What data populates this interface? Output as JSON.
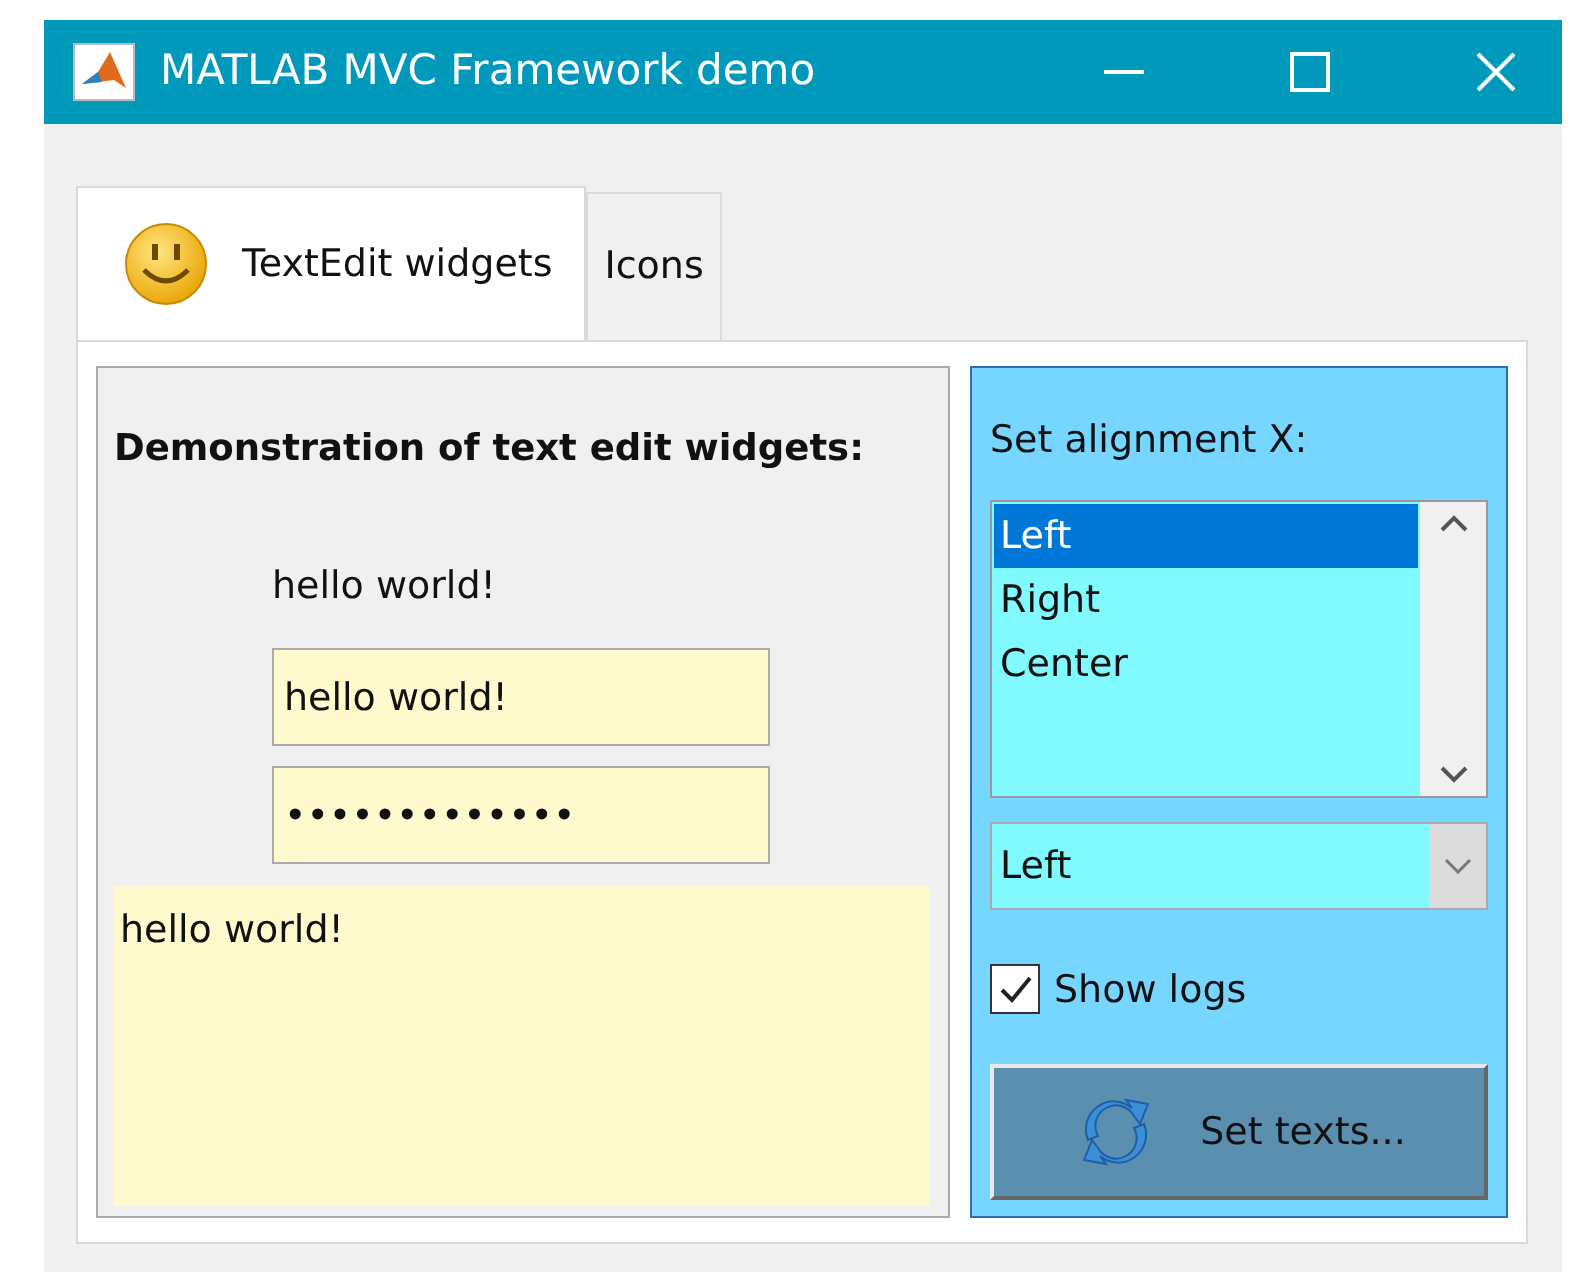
{
  "window": {
    "title": "MATLAB MVC Framework demo"
  },
  "tabs": [
    {
      "label": "TextEdit widgets",
      "selected": true,
      "kind": "icon"
    },
    {
      "label": "Icons",
      "selected": false,
      "kind": "plain"
    }
  ],
  "left_panel": {
    "heading": "Demonstration of text edit widgets:",
    "label": "hello world!",
    "text_field": "hello world!",
    "password_field": "•••••••••••••",
    "text_area": "hello world!"
  },
  "right_panel": {
    "alignment_label": "Set alignment X:",
    "listbox": [
      {
        "label": "Left",
        "selected": true
      },
      {
        "label": "Right",
        "selected": false
      },
      {
        "label": "Center",
        "selected": false
      }
    ],
    "dropdown": "Left",
    "checkbox": {
      "label": "Show logs",
      "checked": true
    },
    "button": "Set texts..."
  }
}
